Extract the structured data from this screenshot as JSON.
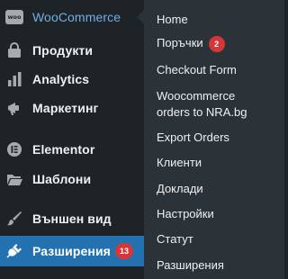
{
  "menu": {
    "woocommerce": {
      "label": "WooCommerce",
      "logo_text": "woo",
      "icon": "woo-logo-icon"
    },
    "products": {
      "label": "Продукти",
      "icon": "archive-icon"
    },
    "analytics": {
      "label": "Analytics",
      "icon": "bar-chart-icon"
    },
    "marketing": {
      "label": "Маркетинг",
      "icon": "megaphone-icon"
    },
    "elementor": {
      "label": "Elementor",
      "icon": "elementor-icon"
    },
    "templates": {
      "label": "Шаблони",
      "icon": "folder-icon"
    },
    "appearance": {
      "label": "Външен вид",
      "icon": "paintbrush-icon"
    },
    "plugins": {
      "label": "Разширения",
      "icon": "plugin-icon",
      "badge": "13"
    }
  },
  "submenu": {
    "home": "Home",
    "orders": {
      "label": "Поръчки",
      "badge": "2"
    },
    "checkout_form": "Checkout Form",
    "nra_line1": "Woocommerce",
    "nra_line2": "orders to NRA.bg",
    "export_orders": "Export Orders",
    "customers": "Клиенти",
    "reports": "Доклади",
    "settings": "Настройки",
    "status": "Статут",
    "extensions": "Разширения"
  },
  "colors": {
    "menu_bg": "#1d2327",
    "submenu_bg": "#2c3338",
    "active_bg": "#2271b1",
    "highlight_text": "#72aee6",
    "badge": "#d63638"
  }
}
